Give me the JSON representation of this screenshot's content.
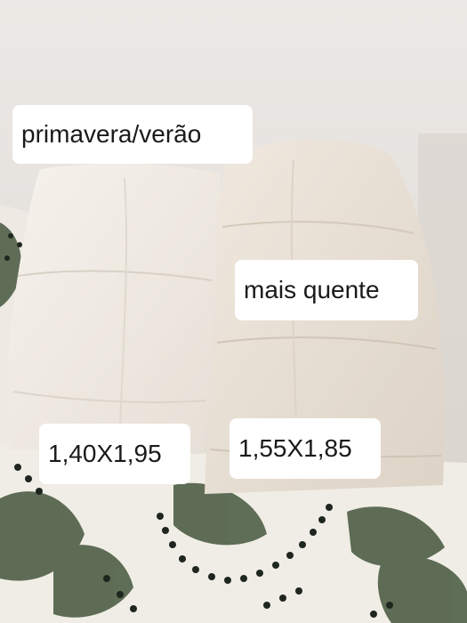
{
  "photo": {
    "subject": "two folded duvets",
    "colors": {
      "wall": "#e9e6e3",
      "duvet_left": "#f1ece6",
      "duvet_right": "#e9e1d6",
      "bedspread": "#f0ede6",
      "pattern_green": "#4f5f46",
      "pattern_dots": "#1f2620",
      "label_bg": "#ffffff"
    }
  },
  "labels": {
    "spring_summer": "primavera/verão",
    "warmer": "mais quente",
    "size_left": "1,40X1,95",
    "size_right": "1,55X1,85"
  }
}
